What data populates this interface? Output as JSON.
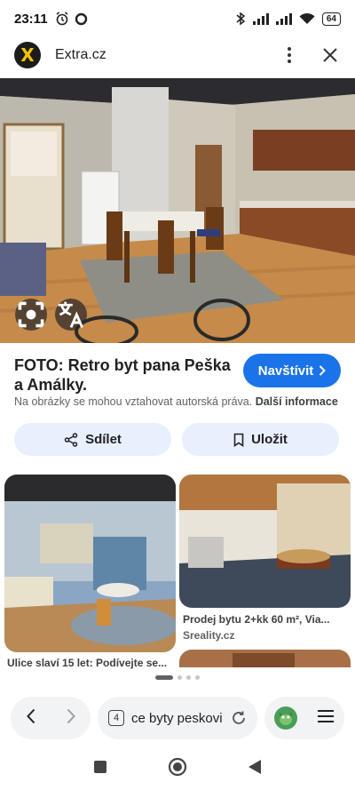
{
  "status_bar": {
    "time": "23:11",
    "battery": "64",
    "icons": [
      "alarm-icon",
      "circle-icon",
      "bluetooth-icon",
      "signal-icon",
      "signal-icon",
      "wifi-icon",
      "battery-icon"
    ]
  },
  "header": {
    "site_name": "Extra.cz",
    "logo_letter": "X"
  },
  "hero": {
    "lens_icon": "lens-icon",
    "translate_icon": "translate-icon"
  },
  "result": {
    "title": "FOTO: Retro byt pana Peška a Amálky.",
    "visit_label": "Navštívit",
    "copyright_text": "Na obrázky se mohou vztahovat autorská práva.",
    "more_info": "Další informace"
  },
  "actions": {
    "share_label": "Sdílet",
    "save_label": "Uložit"
  },
  "related": [
    {
      "caption": "Ulice slaví 15 let: Podívejte se..."
    },
    {
      "caption": "Prodej bytu 2+kk 60 m², Via...",
      "source": "Sreality.cz"
    }
  ],
  "pager": {
    "pages": 4,
    "active": 1
  },
  "browser": {
    "tab_count": "4",
    "url_text": "ce byty peskovi"
  },
  "colors": {
    "accent": "#1a73e8",
    "pill_bg": "#e8f0fe",
    "logo_yellow": "#f5c400"
  }
}
